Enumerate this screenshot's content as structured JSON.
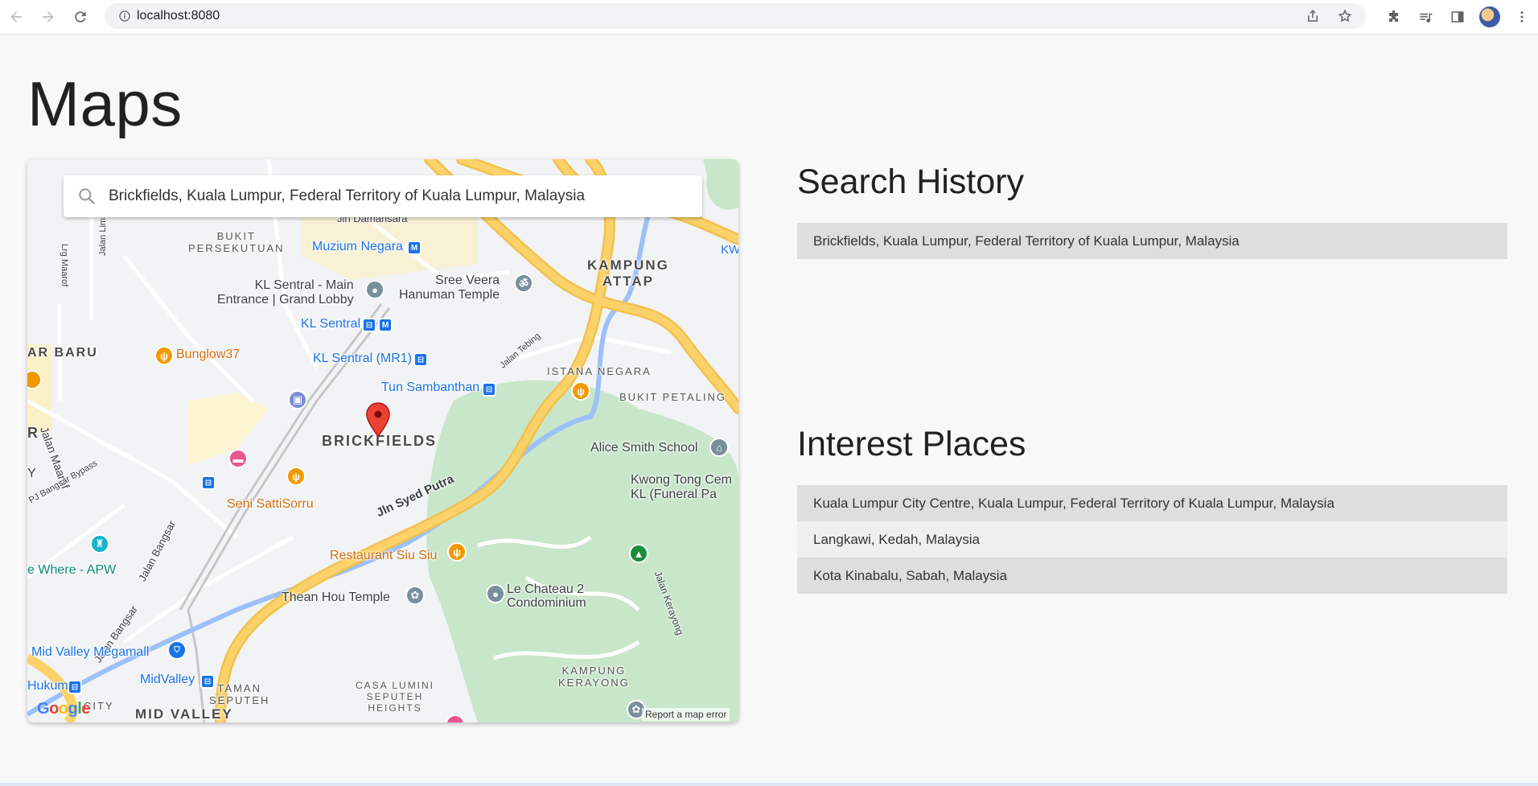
{
  "browser": {
    "url": "localhost:8080"
  },
  "page": {
    "title": "Maps"
  },
  "map": {
    "search_value": "Brickfields, Kuala Lumpur, Federal Territory of Kuala Lumpur, Malaysia",
    "labels": {
      "bukit_persekutuan": "BUKIT\nPERSEKUTUAN",
      "muzium_negara": "Muzium Negara",
      "kampung_attap": "KAMPUNG\nATTAP",
      "kl_sentral_main": "KL Sentral - Main\nEntrance | Grand Lobby",
      "sree_veera": "Sree Veera\nHanuman Temple",
      "kl_sentral": "KL Sentral",
      "bunglow37": "Bunglow37",
      "ar_baru": "AR BARU",
      "kl_sentral_mr1": "KL Sentral (MR1)",
      "jalan_tebing": "Jalan Tebing",
      "istana_negara": "ISTANA NEGARA",
      "tun_sambanthan": "Tun Sambanthan",
      "bukit_petaling": "BUKIT PETALING",
      "brickfields": "BRICKFIELDS",
      "alice_smith": "Alice Smith School",
      "kwong_tong": "Kwong Tong Cem\nKL (Funeral Pa",
      "seni_satti": "Seni SattiSorru",
      "jln_syed_putra": "Jln Syed Putra",
      "restaurant_siu_siu": "Restaurant Siu Siu",
      "where_apw": "e Where - APW",
      "jalan_bangsar": "Jalan Bangsar",
      "thean_hou": "Thean Hou Temple",
      "le_chateau": "Le Chateau 2\nCondominium",
      "jalan_kerayong": "Jalan Kerayong",
      "kampung_kerayong": "KAMPUNG\nKERAYONG",
      "mid_valley_megamall": "Mid Valley Megamall",
      "midvalley": "MidValley",
      "taman_seputeh": "TAMAN\nSEPUTEH",
      "casa_lumini": "CASA LUMINI\nSEPUTEH\nHEIGHTS",
      "hukum": "Hukum",
      "mid_valley": "MID VALLEY",
      "jalan_maarof": "Jalan Maarof",
      "jalan_bangsar_2": "Jalan Bangsar",
      "pj_bangsar": "PJ Bangsar Bypass",
      "lrg_maarof": "Lrg Maarof",
      "jalan_limau_manis": "Jalan Limau Manis",
      "jln_damansara": "Jln Damansara",
      "kw": "KW",
      "r": "R",
      "y": "Y",
      "city": "CITY"
    },
    "google_logo": "Google",
    "report_link": "Report a map error",
    "colors": {
      "highway": "#fbd26a",
      "water": "#9cc0f9",
      "park": "#c3e6cb",
      "pin": "#ea4335"
    }
  },
  "search_history": {
    "title": "Search History",
    "items": [
      "Brickfields, Kuala Lumpur, Federal Territory of Kuala Lumpur, Malaysia"
    ]
  },
  "interest_places": {
    "title": "Interest Places",
    "items": [
      "Kuala Lumpur City Centre, Kuala Lumpur, Federal Territory of Kuala Lumpur, Malaysia",
      "Langkawi, Kedah, Malaysia",
      "Kota Kinabalu, Sabah, Malaysia"
    ]
  }
}
